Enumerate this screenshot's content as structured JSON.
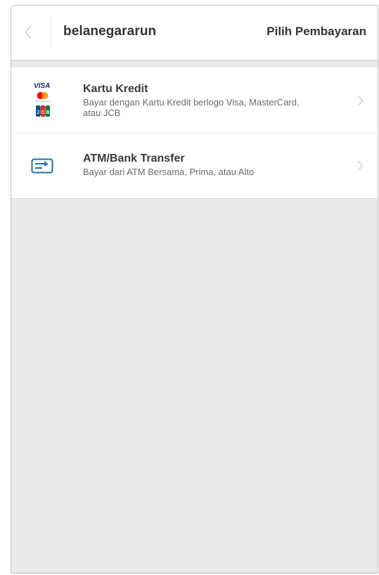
{
  "header": {
    "back_icon": "chevron-left-icon",
    "merchant_name": "belanegararun",
    "title": "Pilih Pembayaran"
  },
  "payment_methods": [
    {
      "icon": "card-logos-icon",
      "logo_text": "VISA",
      "title": "Kartu Kredit",
      "description": "Bayar dengan Kartu Kredit berlogo Visa, MasterCard, atau JCB"
    },
    {
      "icon": "bank-transfer-icon",
      "title": "ATM/Bank Transfer",
      "description": "Bayar dari ATM Bersama, Prima, atau Alto"
    }
  ],
  "colors": {
    "accent": "#1f6fa8",
    "background": "#eaeaea",
    "card": "#ffffff",
    "title_text": "#333333"
  }
}
